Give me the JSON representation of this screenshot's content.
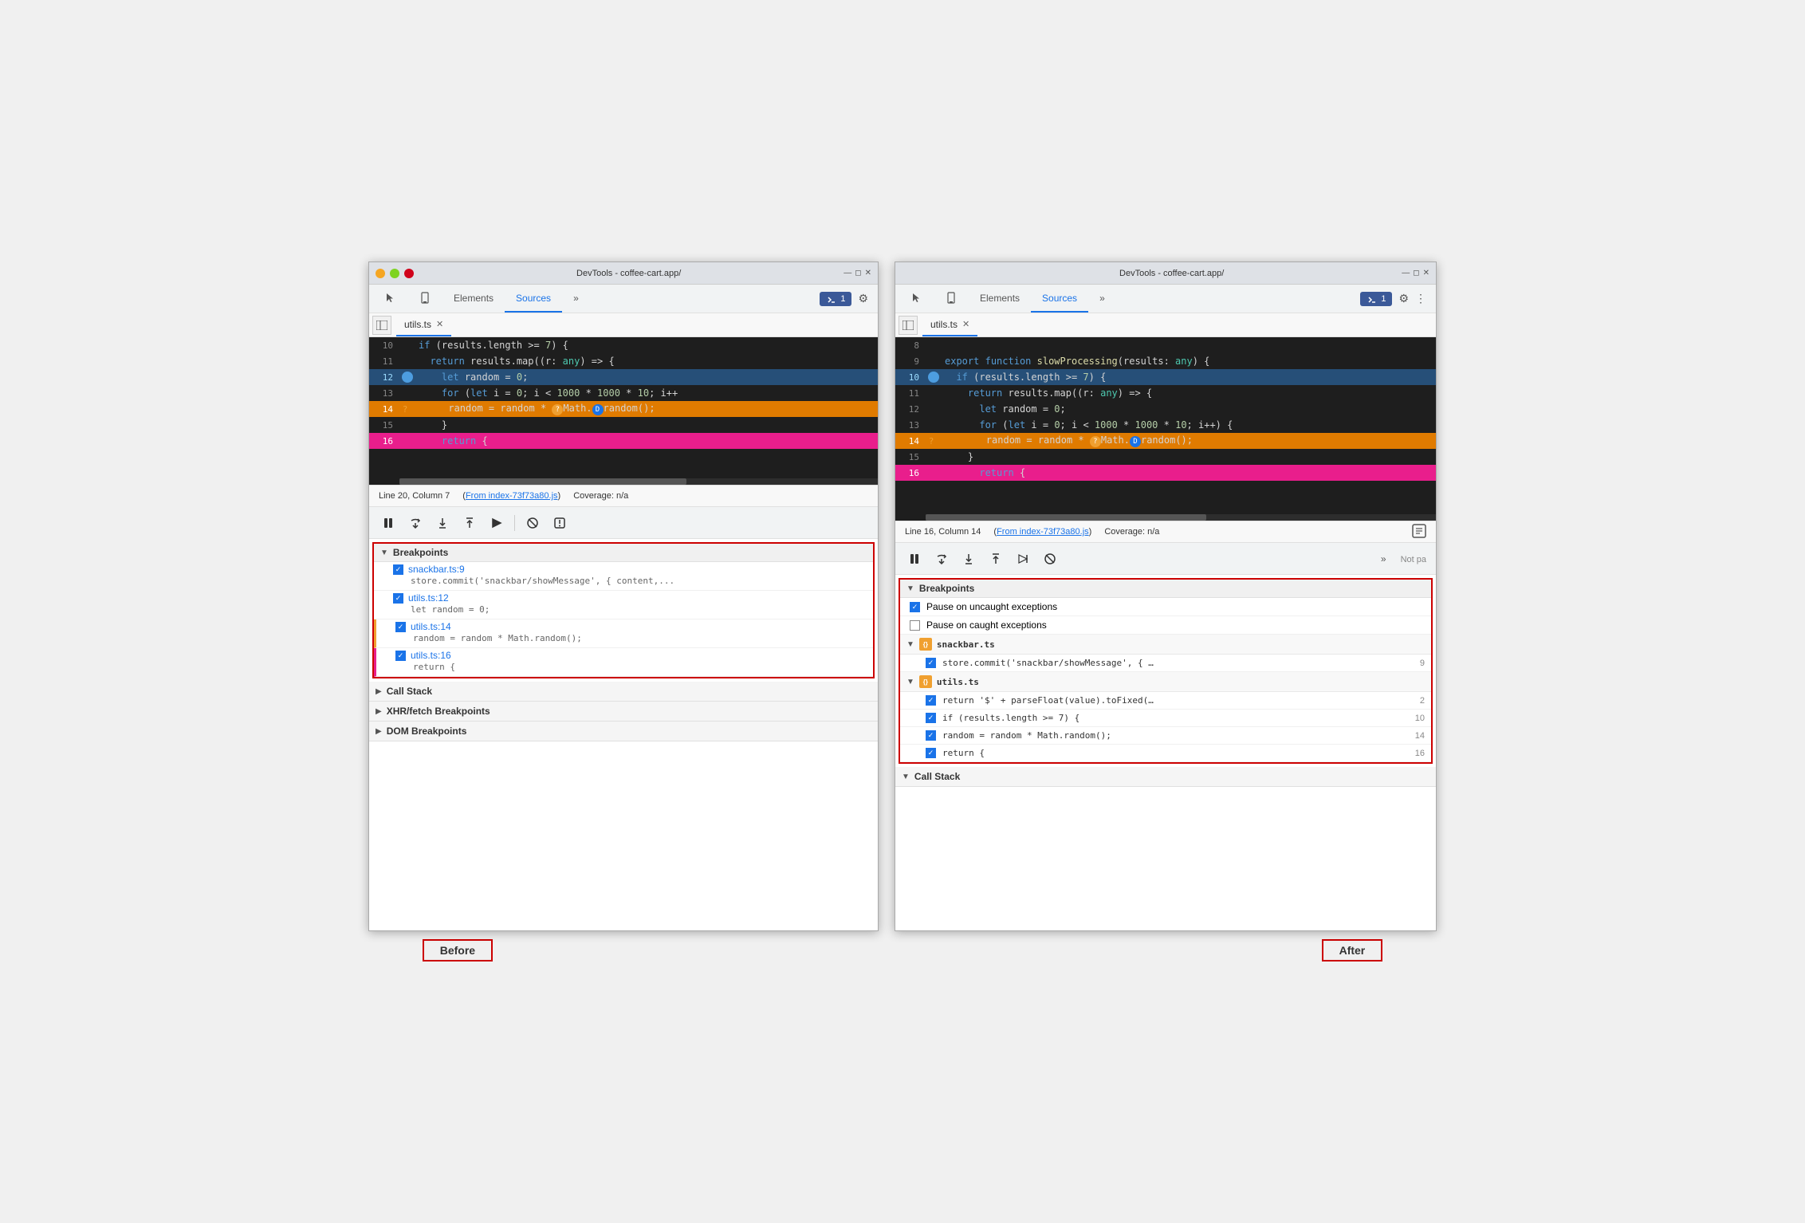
{
  "left_window": {
    "title": "DevTools - coffee-cart.app/",
    "tab_elements": "Elements",
    "tab_sources": "Sources",
    "tab_more": "»",
    "badge": "1",
    "file_tab": "utils.ts",
    "code_lines": [
      {
        "num": "10",
        "content": "    if (results.length >= 7) {",
        "highlight": false
      },
      {
        "num": "11",
        "content": "      return results.map((r: any) => {",
        "highlight": false
      },
      {
        "num": "12",
        "content": "        let random = 0;",
        "highlight": true,
        "bp": "blue"
      },
      {
        "num": "13",
        "content": "        for (let i = 0; i < 1000 * 1000 * 10; i++",
        "highlight": false
      },
      {
        "num": "14",
        "content": "          random = random * 🟡Math.🔵random();",
        "highlight": false,
        "bp": "question"
      },
      {
        "num": "15",
        "content": "        }",
        "highlight": false
      },
      {
        "num": "16",
        "content": "        return {",
        "highlight": false,
        "bp": "pink"
      }
    ],
    "status_line": "Line 20, Column 7",
    "status_from": "From index-73f73a80.js",
    "status_coverage": "Coverage: n/a",
    "toolbar_buttons": [
      "pause",
      "step-over",
      "step-into",
      "step-out",
      "step",
      "deactivate",
      "pause-on-exception"
    ],
    "breakpoints_section": "Breakpoints",
    "breakpoints": [
      {
        "file": "snackbar.ts:9",
        "code": "store.commit('snackbar/showMessage', { content,..."
      },
      {
        "file": "utils.ts:12",
        "code": "let random = 0;"
      },
      {
        "file": "utils.ts:14",
        "code": "random = random * Math.random();"
      },
      {
        "file": "utils.ts:16",
        "code": "return {"
      }
    ],
    "call_stack": "Call Stack",
    "xhr_breakpoints": "XHR/fetch Breakpoints",
    "dom_breakpoints": "DOM Breakpoints"
  },
  "right_window": {
    "title": "DevTools - coffee-cart.app/",
    "tab_elements": "Elements",
    "tab_sources": "Sources",
    "tab_more": "»",
    "badge": "1",
    "file_tab": "utils.ts",
    "code_lines": [
      {
        "num": "8",
        "content": "",
        "highlight": false
      },
      {
        "num": "9",
        "content": "export function slowProcessing(results: any) {",
        "highlight": false
      },
      {
        "num": "10",
        "content": "  if (results.length >= 7) {",
        "highlight": true,
        "bp": "blue"
      },
      {
        "num": "11",
        "content": "    return results.map((r: any) => {",
        "highlight": false
      },
      {
        "num": "12",
        "content": "      let random = 0;",
        "highlight": false
      },
      {
        "num": "13",
        "content": "      for (let i = 0; i < 1000 * 1000 * 10; i++) {",
        "highlight": false
      },
      {
        "num": "14",
        "content": "        random = random * 🟡Math.🔵random();",
        "highlight": false,
        "bp": "question"
      },
      {
        "num": "15",
        "content": "    }",
        "highlight": false
      },
      {
        "num": "16",
        "content": "      return {",
        "highlight": false,
        "bp": "pink"
      }
    ],
    "status_line": "Line 16, Column 14",
    "status_from": "From index-73f73a80.js",
    "status_coverage": "Coverage: n/a",
    "toolbar_buttons": [
      "pause",
      "step-over",
      "step-into",
      "step-out",
      "step",
      "deactivate"
    ],
    "toolbar_more": "»",
    "not_paused": "Not pa",
    "breakpoints_section": "Breakpoints",
    "pause_uncaught": "Pause on uncaught exceptions",
    "pause_caught": "Pause on caught exceptions",
    "file_groups": [
      {
        "name": "snackbar.ts",
        "breakpoints": [
          {
            "code": "store.commit('snackbar/showMessage', { …",
            "line": "9"
          }
        ]
      },
      {
        "name": "utils.ts",
        "breakpoints": [
          {
            "code": "return '$' + parseFloat(value).toFixed(…",
            "line": "2"
          },
          {
            "code": "if (results.length >= 7) {",
            "line": "10"
          },
          {
            "code": "random = random * Math.random();",
            "line": "14"
          },
          {
            "code": "return {",
            "line": "16"
          }
        ]
      }
    ],
    "call_stack": "Call Stack"
  },
  "labels": {
    "before": "Before",
    "after": "After"
  }
}
